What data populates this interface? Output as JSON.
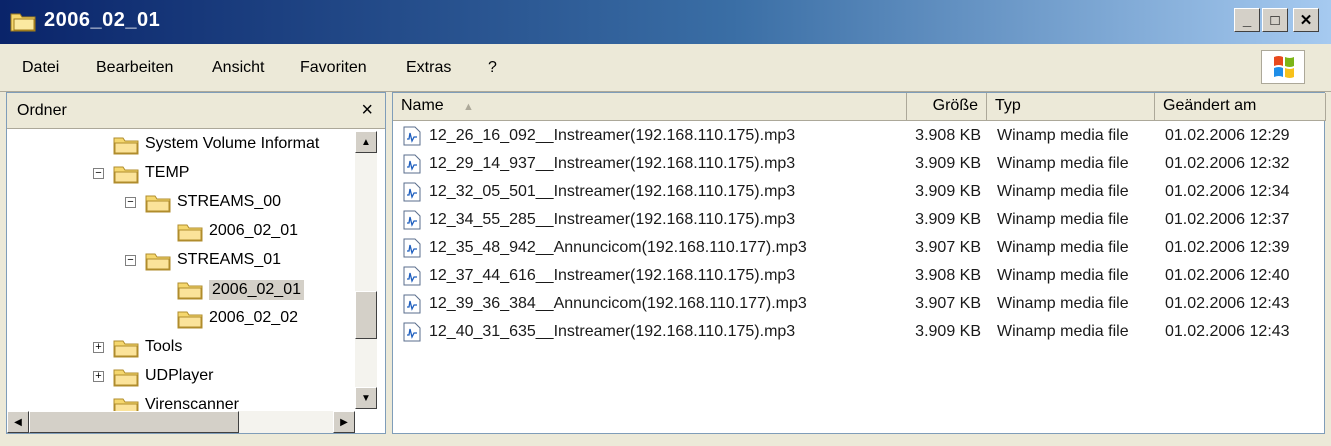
{
  "window": {
    "title": "2006_02_01",
    "buttons": [
      "minimize-icon",
      "restore-icon",
      "close-icon"
    ]
  },
  "menu": [
    "Datei",
    "Bearbeiten",
    "Ansicht",
    "Favoriten",
    "Extras",
    "?"
  ],
  "folder_pane": {
    "title": "Ordner",
    "close_label": "×",
    "tree": [
      {
        "label": "System Volume Informat",
        "level": 2,
        "expander": ""
      },
      {
        "label": "TEMP",
        "level": 2,
        "expander": "−"
      },
      {
        "label": "STREAMS_00",
        "level": 3,
        "expander": "−"
      },
      {
        "label": "2006_02_01",
        "level": 4,
        "expander": ""
      },
      {
        "label": "STREAMS_01",
        "level": 3,
        "expander": "−"
      },
      {
        "label": "2006_02_01",
        "level": 4,
        "expander": "",
        "selected": true
      },
      {
        "label": "2006_02_02",
        "level": 4,
        "expander": ""
      },
      {
        "label": "Tools",
        "level": 2,
        "expander": "+"
      },
      {
        "label": "UDPlayer",
        "level": 2,
        "expander": "+"
      },
      {
        "label": "Virenscanner",
        "level": 2,
        "expander": ""
      }
    ]
  },
  "file_list": {
    "columns": [
      "Name",
      "Größe",
      "Typ",
      "Geändert am"
    ],
    "sort_indicator": "▲",
    "rows": [
      {
        "name": "12_26_16_092__Instreamer(192.168.110.175).mp3",
        "size": "3.908 KB",
        "type": "Winamp media file",
        "modified": "01.02.2006 12:29"
      },
      {
        "name": "12_29_14_937__Instreamer(192.168.110.175).mp3",
        "size": "3.909 KB",
        "type": "Winamp media file",
        "modified": "01.02.2006 12:32"
      },
      {
        "name": "12_32_05_501__Instreamer(192.168.110.175).mp3",
        "size": "3.909 KB",
        "type": "Winamp media file",
        "modified": "01.02.2006 12:34"
      },
      {
        "name": "12_34_55_285__Instreamer(192.168.110.175).mp3",
        "size": "3.909 KB",
        "type": "Winamp media file",
        "modified": "01.02.2006 12:37"
      },
      {
        "name": "12_35_48_942__Annuncicom(192.168.110.177).mp3",
        "size": "3.907 KB",
        "type": "Winamp media file",
        "modified": "01.02.2006 12:39"
      },
      {
        "name": "12_37_44_616__Instreamer(192.168.110.175).mp3",
        "size": "3.908 KB",
        "type": "Winamp media file",
        "modified": "01.02.2006 12:40"
      },
      {
        "name": "12_39_36_384__Annuncicom(192.168.110.177).mp3",
        "size": "3.907 KB",
        "type": "Winamp media file",
        "modified": "01.02.2006 12:43"
      },
      {
        "name": "12_40_31_635__Instreamer(192.168.110.175).mp3",
        "size": "3.909 KB",
        "type": "Winamp media file",
        "modified": "01.02.2006 12:43"
      }
    ]
  },
  "colors": {
    "title_bar_start": "#0a246a",
    "title_bar_end": "#a6caf0",
    "chrome": "#ece9d8",
    "folder": "#f5d76e"
  }
}
